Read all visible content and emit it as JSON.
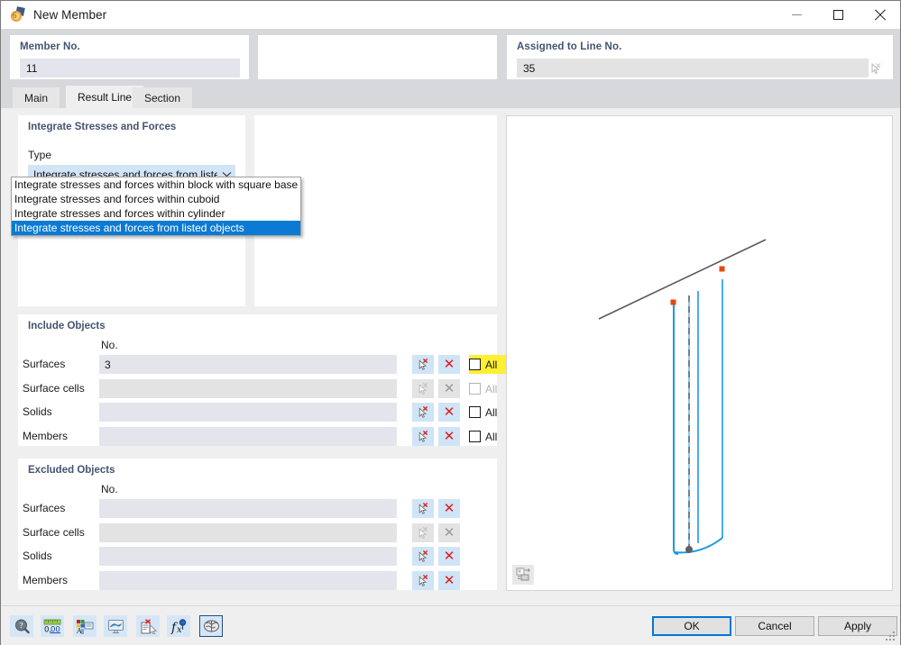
{
  "window": {
    "title": "New Member",
    "icon": "member-orange-icon",
    "controls": {
      "minimize": "minimize-icon",
      "maximize": "maximize-icon",
      "close": "close-icon"
    }
  },
  "top_fields": {
    "member": {
      "label": "Member No.",
      "value": "11"
    },
    "line": {
      "label": "Assigned to Line No.",
      "value": "35"
    }
  },
  "tabs": [
    {
      "label": "Main",
      "active": false
    },
    {
      "label": "Result Line",
      "active": true
    },
    {
      "label": "Section",
      "active": false
    }
  ],
  "integrate_group": {
    "title": "Integrate Stresses and Forces",
    "type_label": "Type",
    "combo_value": "Integrate stresses and forces from listed ...",
    "options": [
      "Integrate stresses and forces within block with square base",
      "Integrate stresses and forces within cuboid",
      "Integrate stresses and forces within cylinder",
      "Integrate stresses and forces from listed objects"
    ],
    "selected_index": 3
  },
  "include_group": {
    "title": "Include Objects",
    "column_header": "No.",
    "all_label": "All",
    "rows": [
      {
        "label": "Surfaces",
        "value": "3",
        "enabled": true,
        "all_checked": false,
        "all_enabled": true,
        "all_highlight": true
      },
      {
        "label": "Surface cells",
        "value": "",
        "enabled": false,
        "all_checked": false,
        "all_enabled": false,
        "all_highlight": false
      },
      {
        "label": "Solids",
        "value": "",
        "enabled": true,
        "all_checked": false,
        "all_enabled": true,
        "all_highlight": false
      },
      {
        "label": "Members",
        "value": "",
        "enabled": true,
        "all_checked": false,
        "all_enabled": true,
        "all_highlight": false
      }
    ]
  },
  "exclude_group": {
    "title": "Excluded Objects",
    "column_header": "No.",
    "rows": [
      {
        "label": "Surfaces",
        "value": "",
        "enabled": true
      },
      {
        "label": "Surface cells",
        "value": "",
        "enabled": false
      },
      {
        "label": "Solids",
        "value": "",
        "enabled": true
      },
      {
        "label": "Members",
        "value": "",
        "enabled": true
      }
    ]
  },
  "preview": {
    "icon": "render-mode-icon",
    "line_color": "#5a5a5a",
    "result_line_color": "#1b9ae0",
    "node_color": "#e04a10"
  },
  "footer": {
    "toolbar": [
      "help-icon",
      "units-icon",
      "display-properties-icon",
      "visual-icon",
      "clear-icon",
      "formula-icon",
      "calculation-icon"
    ],
    "buttons": {
      "ok": "OK",
      "cancel": "Cancel",
      "apply": "Apply"
    }
  },
  "colors": {
    "accent": "#0078d7",
    "highlight": "#ffef33",
    "field": "#e4e4ec",
    "disabled_field": "#e3e3e3",
    "group_title": "#44546f",
    "select_blue": "#0b7ad4"
  }
}
